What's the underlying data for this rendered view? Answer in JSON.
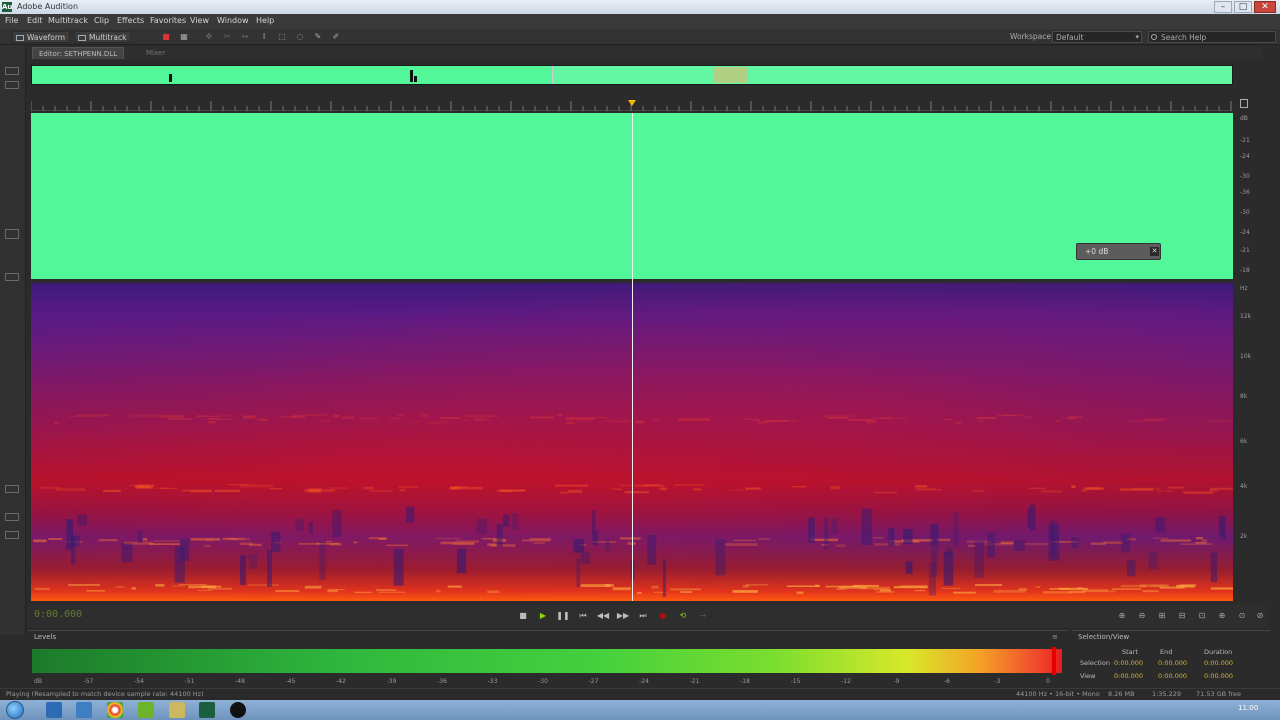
{
  "window": {
    "title": "Adobe Audition",
    "app_icon": "Au",
    "minimize_icon": "minimize-icon",
    "maximize_icon": "maximize-icon",
    "close_icon": "close-icon"
  },
  "menubar": {
    "items": [
      "File",
      "Edit",
      "Multitrack",
      "Clip",
      "Effects",
      "Favorites",
      "View",
      "Window",
      "Help"
    ]
  },
  "toolbar": {
    "waveform_label": "Waveform",
    "multitrack_label": "Multitrack",
    "workspace_label": "Workspace:",
    "workspace_value": "Default",
    "search_placeholder": "Search Help"
  },
  "editor": {
    "tab_label": "Editor: SETHPENN.DLL",
    "mixer_label": "Mixer"
  },
  "waveform": {
    "color": "#52f799"
  },
  "hud": {
    "value": "+0 dB"
  },
  "scales": {
    "db_labels": [
      "dB",
      "-21",
      "-24",
      "-30",
      "-36",
      "-30",
      "-24",
      "-21",
      "-18"
    ],
    "hz_labels": [
      "Hz",
      "12k",
      "10k",
      "8k",
      "6k",
      "4k",
      "2k",
      "1k"
    ]
  },
  "transport": {
    "time": "0:00.000"
  },
  "levels": {
    "tab_label": "Levels",
    "scale": [
      "dB",
      "-57",
      "-54",
      "-51",
      "-48",
      "-45",
      "-42",
      "-39",
      "-36",
      "-33",
      "-30",
      "-27",
      "-24",
      "-21",
      "-18",
      "-15",
      "-12",
      "-9",
      "-6",
      "-3",
      "0"
    ]
  },
  "selection_view": {
    "tab_label": "Selection/View",
    "headers": [
      "Start",
      "End",
      "Duration"
    ],
    "rows": [
      {
        "label": "Selection",
        "start": "0:00.000",
        "end": "0:00.000",
        "duration": "0:00.000"
      },
      {
        "label": "View",
        "start": "0:00.000",
        "end": "0:00.000",
        "duration": "0:00.000"
      }
    ]
  },
  "statusbar": {
    "text": "Playing (Resampled to match device sample rate: 44100 Hz)",
    "format": "44100 Hz • 16-bit • Mono",
    "size": "8.26 MB",
    "duration": "1:35.229",
    "free": "71.53 GB free"
  },
  "taskbar": {
    "clock": "11:00"
  }
}
